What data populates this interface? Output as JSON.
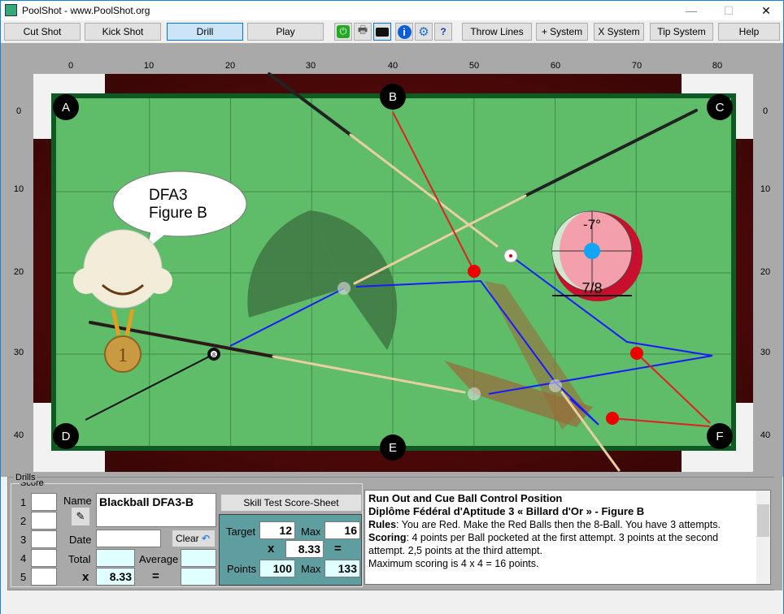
{
  "window": {
    "title": "PoolShot - www.PoolShot.org",
    "minimize": "—",
    "maximize": "☐",
    "close": "✕"
  },
  "toolbar": {
    "buttons": [
      "Cut Shot",
      "Kick Shot",
      "Drill",
      "Play"
    ],
    "selected": "Drill",
    "icons": [
      "power-icon",
      "printer-icon",
      "camera-icon",
      "info-icon",
      "settings-gear-icon",
      "help-document-icon"
    ],
    "right_buttons": [
      "Throw Lines",
      "+ System",
      "X System",
      "Tip System",
      "Help"
    ]
  },
  "table": {
    "x_ticks": [
      "0",
      "10",
      "20",
      "30",
      "40",
      "50",
      "60",
      "70",
      "80"
    ],
    "y_ticks": [
      "0",
      "10",
      "20",
      "30",
      "40"
    ],
    "pockets": [
      "A",
      "B",
      "C",
      "D",
      "E",
      "F"
    ],
    "cloth_color": "#5fbd6a",
    "speech_bubble": {
      "line1": "DFA3",
      "line2": "Figure B"
    },
    "medal": "1",
    "eight_ball": "8",
    "cue_diagram": {
      "angle": "-7°",
      "fraction": "7/8"
    }
  },
  "drills": {
    "group_label": "Drills",
    "score": {
      "label": "Score",
      "rows": [
        "1",
        "2",
        "3",
        "4",
        "5"
      ],
      "name_label": "Name",
      "name_value": "Blackball DFA3-B",
      "date_label": "Date",
      "date_value": "",
      "clear_label": "Clear",
      "total_label": "Total",
      "average_label": "Average",
      "x_label": "x",
      "multiplier": "8.33",
      "equals": "="
    },
    "skill_test": {
      "button": "Skill Test Score-Sheet",
      "target_label": "Target",
      "target": "12",
      "max_label": "Max",
      "max": "16",
      "x_label": "x",
      "multiplier": "8.33",
      "equals": "=",
      "points_label": "Points",
      "points": "100",
      "max_points_label": "Max",
      "max_points": "133"
    },
    "description": {
      "title": "Run Out and Cue Ball Control Position",
      "subtitle": "Diplôme Fédéral d'Aptitude 3 « Billard d'Or » - Figure B",
      "rules_label": "Rules",
      "rules": ": You are Red. Make the Red Balls then the 8-Ball. You have 3 attempts.",
      "scoring_label": "Scoring",
      "scoring": ": 4 points per Ball pocketed at the first attempt. 3 points at the second attempt. 2,5 points at the third attempt.",
      "max": "Maximum scoring is 4 x 4 = 16 points."
    }
  }
}
